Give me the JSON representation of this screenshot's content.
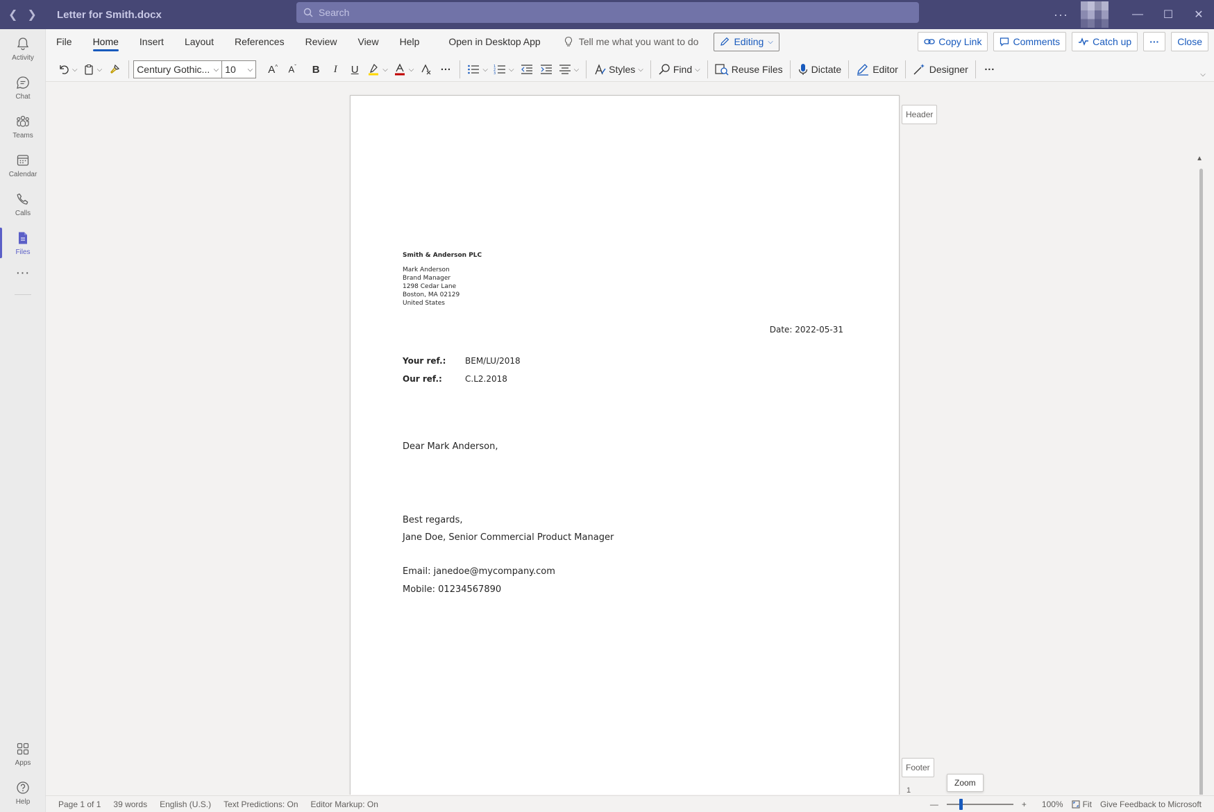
{
  "titlebar": {
    "doc_title": "Letter for Smith.docx",
    "search_placeholder": "Search",
    "more": "···"
  },
  "rail": {
    "items": [
      {
        "label": "Activity"
      },
      {
        "label": "Chat"
      },
      {
        "label": "Teams"
      },
      {
        "label": "Calendar"
      },
      {
        "label": "Calls"
      },
      {
        "label": "Files"
      }
    ],
    "more": "···",
    "apps": "Apps",
    "help": "Help"
  },
  "ribbon": {
    "tabs": [
      "File",
      "Home",
      "Insert",
      "Layout",
      "References",
      "Review",
      "View",
      "Help",
      "Open in Desktop App"
    ],
    "active_tab": "Home",
    "tell_me": "Tell me what you want to do",
    "editing": "Editing",
    "copy_link": "Copy Link",
    "comments": "Comments",
    "catch_up": "Catch up",
    "more": "···",
    "close": "Close",
    "font_name": "Century Gothic...",
    "font_size": "10",
    "styles": "Styles",
    "find": "Find",
    "reuse_files": "Reuse Files",
    "dictate": "Dictate",
    "editor": "Editor",
    "designer": "Designer",
    "more_tools": "···"
  },
  "document": {
    "header_tag": "Header",
    "footer_tag": "Footer",
    "company": "Smith & Anderson PLC",
    "address_lines": [
      "Mark Anderson",
      "Brand Manager",
      "1298 Cedar Lane",
      "Boston, MA 02129",
      "United States"
    ],
    "date": "Date: 2022-05-31",
    "your_ref_label": "Your ref.:",
    "your_ref_value": "BEM/LU/2018",
    "our_ref_label": "Our ref.:",
    "our_ref_value": "C.L2.2018",
    "greeting": "Dear Mark Anderson,",
    "closing": "Best regards,",
    "signature": "Jane Doe, Senior Commercial Product Manager",
    "email": "Email: janedoe@mycompany.com",
    "mobile": "Mobile: 01234567890",
    "page_number": "1"
  },
  "statusbar": {
    "page": "Page 1 of 1",
    "words": "39 words",
    "language": "English (U.S.)",
    "text_predictions": "Text Predictions: On",
    "editor_markup": "Editor Markup: On",
    "zoom_minus": "—",
    "zoom_plus": "+",
    "zoom_level": "100%",
    "fit": "Fit",
    "feedback": "Give Feedback to Microsoft",
    "zoom_tooltip": "Zoom"
  },
  "colors": {
    "titlebar": "#464775",
    "accent": "#5b5fc7",
    "word_blue": "#185abd"
  }
}
